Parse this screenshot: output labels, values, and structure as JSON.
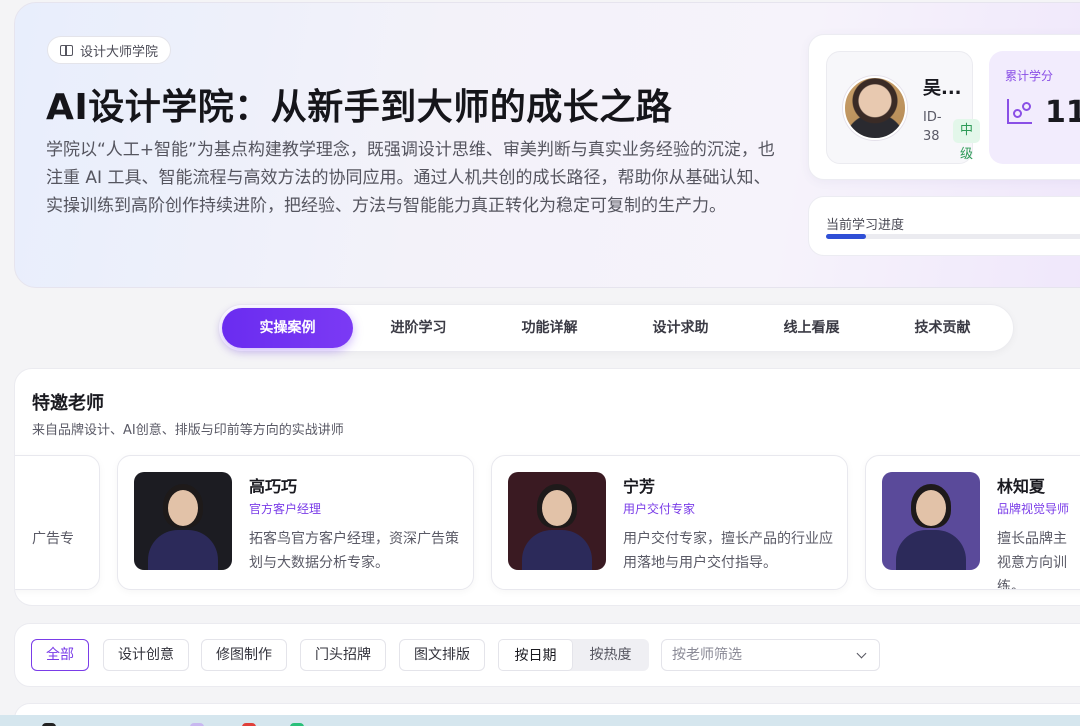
{
  "hero": {
    "tag": "设计大师学院",
    "title": "AI设计学院：从新手到大师的成长之路",
    "description": "学院以“人工+智能”为基点构建教学理念，既强调设计思维、审美判断与真实业务经验的沉淀，也注重 AI 工具、智能流程与高效方法的协同应用。通过人机共创的成长路径，帮助你从基础认知、实操训练到高阶创作持续进阶，把经验、方法与智能能力真正转化为稳定可复制的生产力。"
  },
  "profile": {
    "name": "吴...",
    "id": "ID-38",
    "level": "中级",
    "credit_label": "累计学分",
    "credit_value": "11",
    "progress_label": "当前学习进度",
    "progress_fraction": 0.133
  },
  "tabs": [
    "实操案例",
    "进阶学习",
    "功能详解",
    "设计求助",
    "线上看展",
    "技术贡献"
  ],
  "teachers": {
    "title": "特邀老师",
    "subtitle": "来自品牌设计、AI创意、排版与印前等方向的实战讲师",
    "partial_left_text": "广告专",
    "cards": [
      {
        "name": "高巧巧",
        "role": "官方客户经理",
        "desc": "拓客鸟官方客户经理，资深广告策划与大数据分析专家。",
        "bg": "#1c1c22"
      },
      {
        "name": "宁芳",
        "role": "用户交付专家",
        "desc": "用户交付专家，擅长产品的行业应用落地与用户交付指导。",
        "bg": "#3a1a22"
      },
      {
        "name": "林知夏",
        "role": "品牌视觉导师",
        "desc": "擅长品牌主视意方向训练。",
        "bg": "#5a4a9a"
      }
    ]
  },
  "filters": {
    "chips": [
      "全部",
      "设计创意",
      "修图制作",
      "门头招牌",
      "图文排版"
    ],
    "sort": [
      "按日期",
      "按热度"
    ],
    "teacher_placeholder": "按老师筛选"
  },
  "colors": {
    "accent": "#7a3ce8",
    "tab_active": "#6a2cf0",
    "level_green": "#2d9a57",
    "progress": "#2f4fd6"
  }
}
